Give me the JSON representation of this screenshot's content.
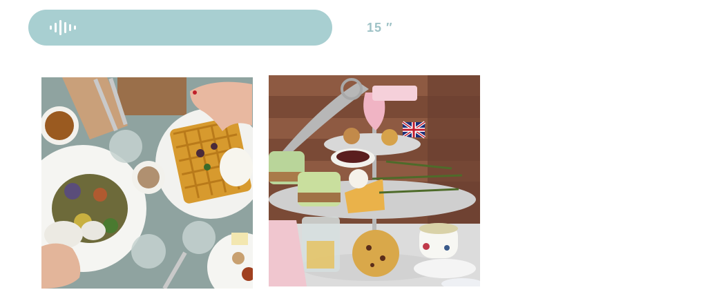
{
  "voice_message": {
    "icon": "voice-wave-icon",
    "bar_color": "#a8cfd1",
    "duration_text": "15 ″"
  },
  "photos": [
    {
      "icon": "brunch-photo"
    },
    {
      "icon": "afternoon-tea-photo"
    }
  ]
}
